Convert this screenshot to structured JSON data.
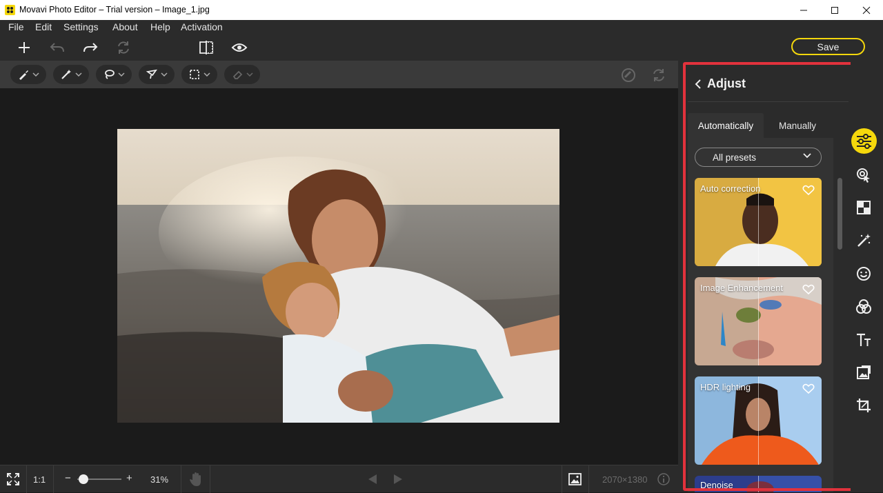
{
  "window": {
    "title": "Movavi Photo Editor – Trial version – Image_1.jpg"
  },
  "menu": [
    "File",
    "Edit",
    "Settings",
    "About",
    "Help",
    "Activation"
  ],
  "toolbar": {
    "save_label": "Save"
  },
  "bottom_bar": {
    "actual_size_label": "1:1",
    "zoom_percent": "31%",
    "zoom_minus": "−",
    "zoom_plus": "+",
    "zoom_slider_value": 0.05,
    "image_dimensions": "2070×1380"
  },
  "panel": {
    "title": "Adjust",
    "tabs": [
      "Automatically",
      "Manually"
    ],
    "active_tab": "Automatically",
    "presets_filter": "All presets",
    "presets": [
      {
        "label": "Auto correction"
      },
      {
        "label": "Image Enhancement"
      },
      {
        "label": "HDR lighting"
      },
      {
        "label": "Denoise"
      }
    ]
  },
  "colors": {
    "accent": "#f5d80c",
    "highlight_outline": "#e2323c",
    "panel_bg": "#2b2b2b",
    "canvas_bg": "#1b1b1b"
  },
  "icons": {
    "rail": [
      "adjust-icon",
      "retouch-icon",
      "background-icon",
      "magic-wand-icon",
      "face-icon",
      "filters-icon",
      "text-icon",
      "watermark-icon",
      "crop-icon"
    ]
  }
}
